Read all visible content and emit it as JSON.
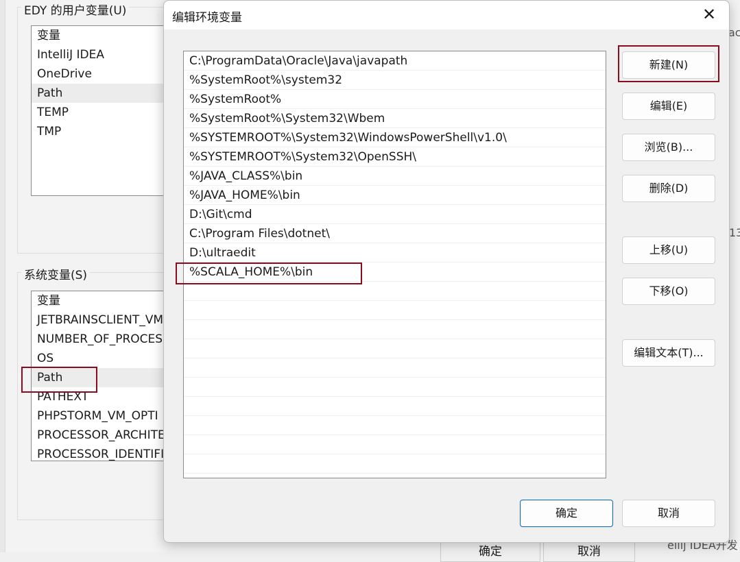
{
  "background": {
    "user_vars_label": "EDY 的用户变量(U)",
    "user_vars": [
      "变量",
      "IntelliJ IDEA",
      "OneDrive",
      "Path",
      "TEMP",
      "TMP"
    ],
    "system_vars_label": "系统变量(S)",
    "system_vars": [
      "变量",
      "JETBRAINSCLIENT_VM",
      "NUMBER_OF_PROCES",
      "OS",
      "Path",
      "PATHEXT",
      "PHPSTORM_VM_OPTI",
      "PROCESSOR_ARCHITE",
      "PROCESSOR_IDENTIFI"
    ],
    "ok_label": "确定",
    "cancel_label": "取消",
    "right_fragment_1": "ac",
    "right_fragment_2": "13",
    "right_fragment_3": "ellij IDEA开发"
  },
  "dialog": {
    "title": "编辑环境变量",
    "paths": [
      "C:\\ProgramData\\Oracle\\Java\\javapath",
      "%SystemRoot%\\system32",
      "%SystemRoot%",
      "%SystemRoot%\\System32\\Wbem",
      "%SYSTEMROOT%\\System32\\WindowsPowerShell\\v1.0\\",
      "%SYSTEMROOT%\\System32\\OpenSSH\\",
      "%JAVA_CLASS%\\bin",
      "%JAVA_HOME%\\bin",
      "D:\\Git\\cmd",
      "C:\\Program Files\\dotnet\\",
      "D:\\ultraedit",
      "%SCALA_HOME%\\bin"
    ],
    "buttons": {
      "new": "新建(N)",
      "edit": "编辑(E)",
      "browse": "浏览(B)...",
      "delete": "删除(D)",
      "move_up": "上移(U)",
      "move_down": "下移(O)",
      "edit_text": "编辑文本(T)..."
    },
    "ok": "确定",
    "cancel": "取消"
  },
  "colors": {
    "highlight_box": "#8b0a1e",
    "primary_border": "#0067c0"
  }
}
